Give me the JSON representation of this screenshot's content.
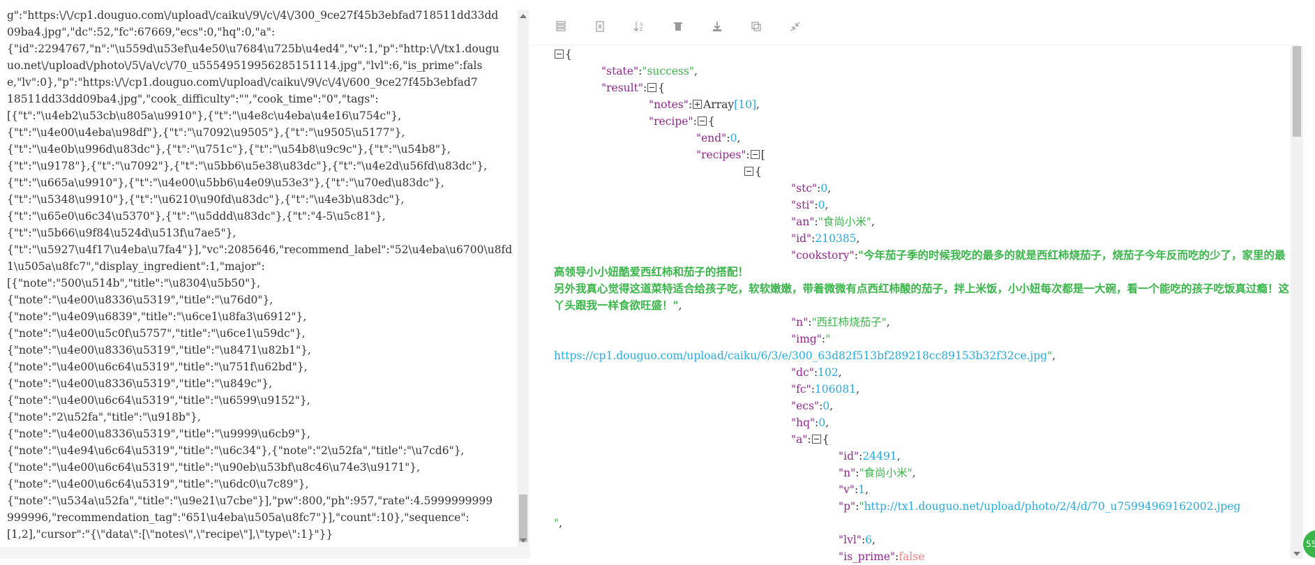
{
  "raw_lines": [
    "g\":\"https:\\/\\/cp1.douguo.com\\/upload\\/caiku\\/9\\/c\\/4\\/300_9ce27f45b3ebfad718511dd33dd",
    "09ba4.jpg\",\"dc\":52,\"fc\":67669,\"ecs\":0,\"hq\":0,\"a\":",
    "{\"id\":2294767,\"n\":\"\\u559d\\u53ef\\u4e50\\u7684\\u725b\\u4ed4\",\"v\":1,\"p\":\"http:\\/\\/tx1.dougu",
    "uo.net\\/upload\\/photo\\/5\\/a\\/c\\/70_u55549519956285151114.jpg\",\"lvl\":6,\"is_prime\":fals",
    "e,\"lv\":0},\"p\":\"https:\\/\\/cp1.douguo.com\\/upload\\/caiku\\/9\\/c\\/4\\/600_9ce27f45b3ebfad7",
    "18511dd33dd09ba4.jpg\",\"cook_difficulty\":\"\",\"cook_time\":\"0\",\"tags\":",
    "[{\"t\":\"\\u4eb2\\u53cb\\u805a\\u9910\"},{\"t\":\"\\u4e8c\\u4eba\\u4e16\\u754c\"},",
    "{\"t\":\"\\u4e00\\u4eba\\u98df\"},{\"t\":\"\\u7092\\u9505\"},{\"t\":\"\\u9505\\u5177\"},",
    "{\"t\":\"\\u4e0b\\u996d\\u83dc\"},{\"t\":\"\\u751c\"},{\"t\":\"\\u54b8\\u9c9c\"},{\"t\":\"\\u54b8\"},",
    "{\"t\":\"\\u9178\"},{\"t\":\"\\u7092\"},{\"t\":\"\\u5bb6\\u5e38\\u83dc\"},{\"t\":\"\\u4e2d\\u56fd\\u83dc\"},",
    "{\"t\":\"\\u665a\\u9910\"},{\"t\":\"\\u4e00\\u5bb6\\u4e09\\u53e3\"},{\"t\":\"\\u70ed\\u83dc\"},",
    "{\"t\":\"\\u5348\\u9910\"},{\"t\":\"\\u6210\\u90fd\\u83dc\"},{\"t\":\"\\u4e3b\\u83dc\"},",
    "{\"t\":\"\\u65e0\\u6c34\\u5370\"},{\"t\":\"\\u5ddd\\u83dc\"},{\"t\":\"4-5\\u5c81\"},",
    "{\"t\":\"\\u5b66\\u9f84\\u524d\\u513f\\u7ae5\"},",
    "{\"t\":\"\\u5927\\u4f17\\u4eba\\u7fa4\"}],\"vc\":2085646,\"recommend_label\":\"52\\u4eba\\u6700\\u8fd",
    "1\\u505a\\u8fc7\",\"display_ingredient\":1,\"major\":",
    "[{\"note\":\"500\\u514b\",\"title\":\"\\u8304\\u5b50\"},",
    "{\"note\":\"\\u4e00\\u8336\\u5319\",\"title\":\"\\u76d0\"},",
    "{\"note\":\"\\u4e09\\u6839\",\"title\":\"\\u6ce1\\u8fa3\\u6912\"},",
    "{\"note\":\"\\u4e00\\u5c0f\\u5757\",\"title\":\"\\u6ce1\\u59dc\"},",
    "{\"note\":\"\\u4e00\\u8336\\u5319\",\"title\":\"\\u8471\\u82b1\"},",
    "{\"note\":\"\\u4e00\\u6c64\\u5319\",\"title\":\"\\u751f\\u62bd\"},",
    "{\"note\":\"\\u4e00\\u8336\\u5319\",\"title\":\"\\u849c\"},",
    "{\"note\":\"\\u4e00\\u6c64\\u5319\",\"title\":\"\\u6599\\u9152\"},",
    "{\"note\":\"2\\u52fa\",\"title\":\"\\u918b\"},",
    "{\"note\":\"\\u4e00\\u8336\\u5319\",\"title\":\"\\u9999\\u6cb9\"},",
    "{\"note\":\"\\u4e94\\u6c64\\u5319\",\"title\":\"\\u6c34\"},{\"note\":\"2\\u52fa\",\"title\":\"\\u7cd6\"},",
    "{\"note\":\"\\u4e00\\u6c64\\u5319\",\"title\":\"\\u90eb\\u53bf\\u8c46\\u74e3\\u9171\"},",
    "{\"note\":\"\\u4e00\\u6c64\\u5319\",\"title\":\"\\u6dc0\\u7c89\"},",
    "{\"note\":\"\\u534a\\u52fa\",\"title\":\"\\u9e21\\u7cbe\"}],\"pw\":800,\"ph\":957,\"rate\":4.5999999999",
    "999996,\"recommendation_tag\":\"651\\u4eba\\u505a\\u8fc7\"}],\"count\":10},\"sequence\":",
    "[1,2],\"cursor\":\"{\\\"data\\\":[\\\"notes\\\",\\\"recipe\\\"],\\\"type\\\":1}\"}}"
  ],
  "toolbar": [
    "format-icon",
    "excel-icon",
    "sort-icon",
    "delete-icon",
    "download-icon",
    "copy-icon",
    "collapse-icon"
  ],
  "json": {
    "state_key": "\"state\"",
    "state_val": "\"success\"",
    "result_key": "\"result\"",
    "notes_key": "\"notes\"",
    "notes_val": "Array",
    "notes_count": "[10]",
    "recipe_key": "\"recipe\"",
    "end_key": "\"end\"",
    "end_val": "0",
    "recipes_key": "\"recipes\"",
    "stc_key": "\"stc\"",
    "stc_val": "0",
    "sti_key": "\"sti\"",
    "sti_val": "0",
    "an_key": "\"an\"",
    "an_val": "\"食尚小米\"",
    "id_key": "\"id\"",
    "id_val": "210385",
    "cookstory_key": "\"cookstory\"",
    "cookstory_val1": "\"今年茄子季的时候我吃的最多的就是西红柿烧茄子，烧茄子今年反而吃的少了，家里的最高领导小小妞酷爱西红柿和茄子的搭配！",
    "cookstory_val2": "另外我真心觉得这道菜特适合给孩子吃，软软嫩嫩，带着微微有点西红柿酸的茄子，拌上米饭，小小妞每次都是一大碗，看一个能吃的孩子吃饭真过瘾！这丫头跟我一样食欲旺盛！\"",
    "n_key": "\"n\"",
    "n_val": "\"西红柿烧茄子\"",
    "img_key": "\"img\"",
    "img_val": "https://cp1.douguo.com/upload/caiku/6/3/e/300_63d82f513bf289218cc89153b32f32ce.jpg",
    "dc_key": "\"dc\"",
    "dc_val": "102",
    "fc_key": "\"fc\"",
    "fc_val": "106081",
    "ecs_key": "\"ecs\"",
    "ecs_val": "0",
    "hq_key": "\"hq\"",
    "hq_val": "0",
    "a_key": "\"a\"",
    "aid_key": "\"id\"",
    "aid_val": "24491",
    "an2_key": "\"n\"",
    "an2_val": "\"食尚小米\"",
    "v_key": "\"v\"",
    "v_val": "1",
    "p_key": "\"p\"",
    "p_val": "http://tx1.douguo.net/upload/photo/2/4/d/70_u75994969162002.jpeg",
    "lvl_key": "\"lvl\"",
    "lvl_val": "6",
    "prime_key": "\"is_prime\"",
    "prime_val": "false"
  },
  "badge": "55"
}
